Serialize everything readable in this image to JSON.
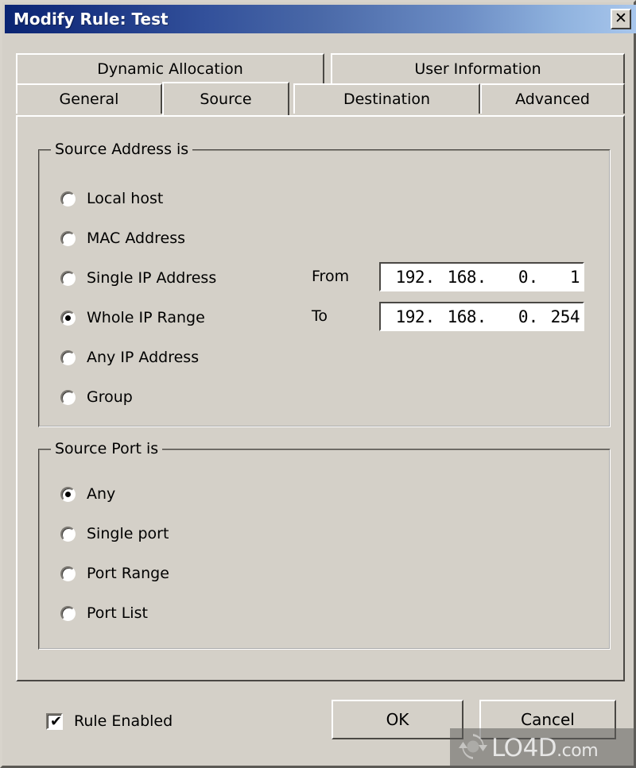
{
  "window": {
    "title": "Modify Rule: Test",
    "close_label": "✕",
    "titlebar_gradient_start": "#0a2472",
    "titlebar_gradient_end": "#a8c6ec",
    "face_color": "#d4d0c8"
  },
  "tabs": {
    "top_row": [
      {
        "label": "Dynamic Allocation",
        "selected": false
      },
      {
        "label": "User Information",
        "selected": false
      }
    ],
    "bottom_row": [
      {
        "label": "General",
        "selected": false
      },
      {
        "label": "Source",
        "selected": true
      },
      {
        "label": "Destination",
        "selected": false
      },
      {
        "label": "Advanced",
        "selected": false
      }
    ]
  },
  "source_address_group": {
    "legend": "Source Address is",
    "options": [
      {
        "label": "Local host",
        "checked": false
      },
      {
        "label": "MAC Address",
        "checked": false
      },
      {
        "label": "Single IP Address",
        "checked": false
      },
      {
        "label": "Whole IP Range",
        "checked": true
      },
      {
        "label": "Any IP Address",
        "checked": false
      },
      {
        "label": "Group",
        "checked": false
      }
    ],
    "from": {
      "label": "From",
      "octets": [
        "192",
        "168",
        "0",
        "1"
      ]
    },
    "to": {
      "label": "To",
      "octets": [
        "192",
        "168",
        "0",
        "254"
      ]
    },
    "separator": "."
  },
  "source_port_group": {
    "legend": "Source Port is",
    "options": [
      {
        "label": "Any",
        "checked": true
      },
      {
        "label": "Single port",
        "checked": false
      },
      {
        "label": "Port Range",
        "checked": false
      },
      {
        "label": "Port List",
        "checked": false
      }
    ]
  },
  "footer": {
    "rule_enabled": {
      "label": "Rule Enabled",
      "checked": true,
      "check_glyph": "✔"
    },
    "ok_label": "OK",
    "cancel_label": "Cancel"
  },
  "watermark": {
    "name": "LO4D",
    "suffix": ".com"
  }
}
